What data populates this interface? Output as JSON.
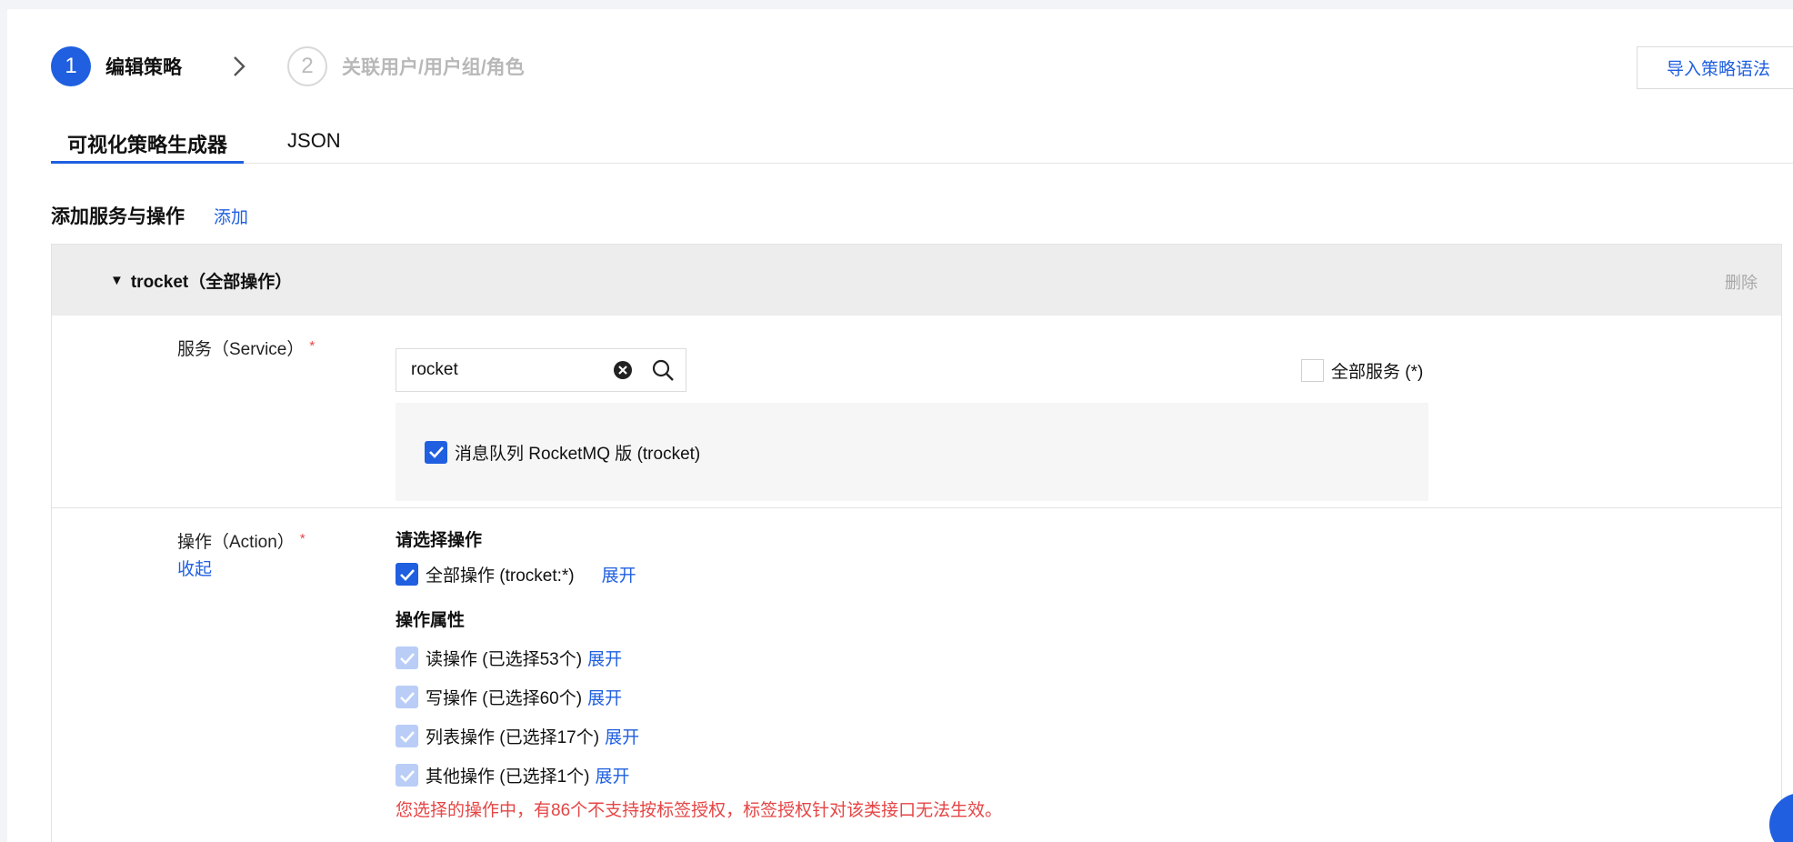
{
  "steps": [
    {
      "number": "1",
      "label": "编辑策略",
      "state": "active"
    },
    {
      "number": "2",
      "label": "关联用户/用户组/角色",
      "state": "inactive"
    }
  ],
  "import_button": "导入策略语法",
  "tabs": [
    {
      "label": "可视化策略生成器",
      "active": true
    },
    {
      "label": "JSON",
      "active": false
    }
  ],
  "section": {
    "title": "添加服务与操作",
    "add_link": "添加"
  },
  "card": {
    "title": "trocket（全部操作）",
    "delete": "删除",
    "service": {
      "label": "服务（Service）",
      "required_mark": "*",
      "search_value": "rocket",
      "all_services_label": "全部服务 (*)",
      "all_services_checked": false,
      "result": {
        "label": "消息队列 RocketMQ 版 (trocket)",
        "checked": true
      }
    },
    "action": {
      "label": "操作（Action）",
      "required_mark": "*",
      "collapse": "收起",
      "select_title": "请选择操作",
      "all_ops": {
        "label": "全部操作 (trocket:*)",
        "checked": true,
        "expand": "展开"
      },
      "attr_title": "操作属性",
      "attrs": [
        {
          "label": "读操作 (已选择53个)",
          "expand": "展开"
        },
        {
          "label": "写操作 (已选择60个)",
          "expand": "展开"
        },
        {
          "label": "列表操作 (已选择17个)",
          "expand": "展开"
        },
        {
          "label": "其他操作 (已选择1个)",
          "expand": "展开"
        }
      ],
      "warning": "您选择的操作中，有86个不支持按标签授权，标签授权针对该类接口无法生效。"
    }
  },
  "colors": {
    "accent": "#1f5fe0",
    "danger": "#e54545",
    "muted": "#a8a8a8"
  }
}
